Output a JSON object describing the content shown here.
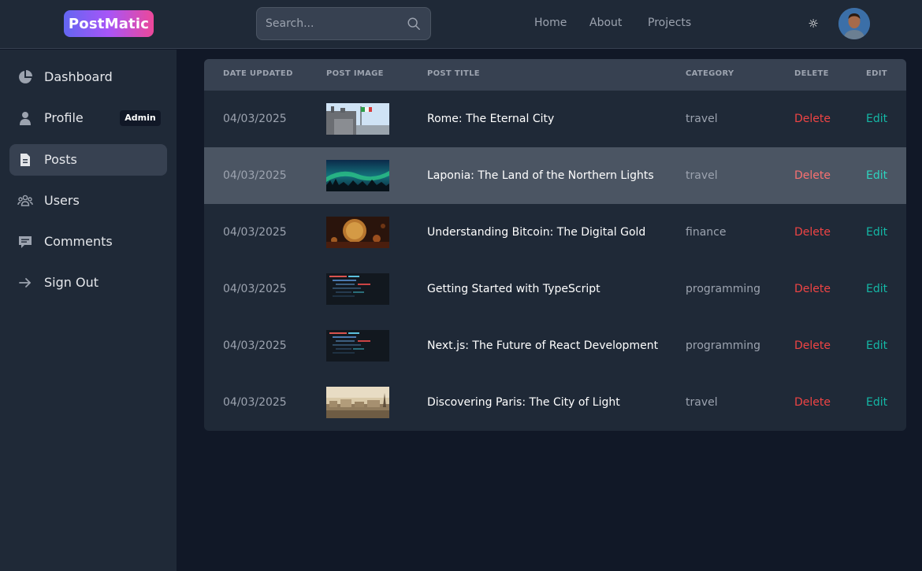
{
  "header": {
    "logo": "PostMatic",
    "search_placeholder": "Search...",
    "nav": [
      {
        "label": "Home"
      },
      {
        "label": "About"
      },
      {
        "label": "Projects"
      }
    ],
    "theme_icon": "sun-icon",
    "avatar_icon": "user-avatar"
  },
  "sidebar": {
    "items": [
      {
        "label": "Dashboard",
        "icon": "pie-chart-icon",
        "active": false
      },
      {
        "label": "Profile",
        "icon": "user-icon",
        "badge": "Admin",
        "active": false
      },
      {
        "label": "Posts",
        "icon": "document-icon",
        "active": true
      },
      {
        "label": "Users",
        "icon": "users-icon",
        "active": false
      },
      {
        "label": "Comments",
        "icon": "comment-icon",
        "active": false
      },
      {
        "label": "Sign Out",
        "icon": "arrow-right-icon",
        "active": false
      }
    ]
  },
  "table": {
    "columns": [
      "DATE UPDATED",
      "POST IMAGE",
      "POST TITLE",
      "CATEGORY",
      "DELETE",
      "EDIT"
    ],
    "rows": [
      {
        "date": "04/03/2025",
        "image": "rome-monument",
        "title": "Rome: The Eternal City",
        "category": "travel",
        "delete": "Delete",
        "edit": "Edit"
      },
      {
        "date": "04/03/2025",
        "image": "northern-lights",
        "title": "Laponia: The Land of the Northern Lights",
        "category": "travel",
        "delete": "Delete",
        "edit": "Edit"
      },
      {
        "date": "04/03/2025",
        "image": "bitcoin-coin",
        "title": "Understanding Bitcoin: The Digital Gold",
        "category": "finance",
        "delete": "Delete",
        "edit": "Edit"
      },
      {
        "date": "04/03/2025",
        "image": "code-screen",
        "title": "Getting Started with TypeScript",
        "category": "programming",
        "delete": "Delete",
        "edit": "Edit"
      },
      {
        "date": "04/03/2025",
        "image": "code-screen",
        "title": "Next.js: The Future of React Development",
        "category": "programming",
        "delete": "Delete",
        "edit": "Edit"
      },
      {
        "date": "04/03/2025",
        "image": "paris-skyline",
        "title": "Discovering Paris: The City of Light",
        "category": "travel",
        "delete": "Delete",
        "edit": "Edit"
      }
    ]
  },
  "colors": {
    "background": "#111827",
    "panel": "#1f2937",
    "header_row": "#374151",
    "highlight_row": "#4b5563",
    "delete": "#ef4444",
    "edit": "#14b8a6",
    "logo_gradient": [
      "#6366f1",
      "#a855f7",
      "#ec4899"
    ]
  }
}
